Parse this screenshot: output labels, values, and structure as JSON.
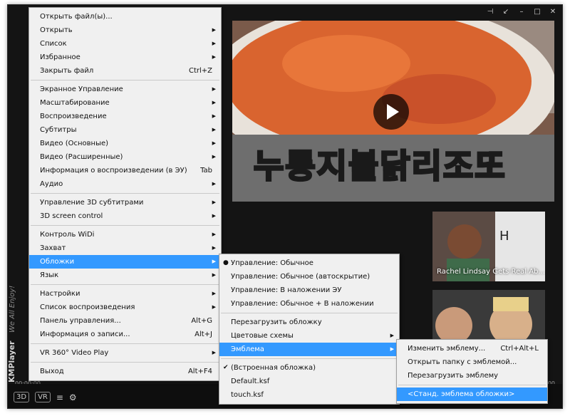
{
  "window": {
    "controls": [
      "pin-icon",
      "minimize-to-tray-icon",
      "minimize-icon",
      "maximize-icon",
      "close-icon"
    ]
  },
  "video": {
    "overlay_text_part1": "누룽지",
    "overlay_text_part2": "불닭",
    "overlay_text_part3": "리조또"
  },
  "thumbnails": [
    {
      "title": "Rachel Lindsay Gets Real Ab..."
    },
    {
      "title": ""
    }
  ],
  "brand": {
    "name": "KMPlayer",
    "tagline": "We All Enjoy!"
  },
  "bottom_bar": {
    "time_left": "00:00:00",
    "time_right": "00:00:00",
    "btn_3d": "3D",
    "btn_vr": "VR"
  },
  "main_menu": {
    "items": [
      {
        "label": "Открыть файл(ы)...",
        "shortcut": "",
        "submenu": false
      },
      {
        "label": "Открыть",
        "shortcut": "",
        "submenu": true
      },
      {
        "label": "Список",
        "shortcut": "",
        "submenu": true
      },
      {
        "label": "Избранное",
        "shortcut": "",
        "submenu": true
      },
      {
        "label": "Закрыть файл",
        "shortcut": "Ctrl+Z",
        "submenu": false
      },
      {
        "label": "Экранное Управление",
        "shortcut": "",
        "submenu": true
      },
      {
        "label": "Масштабирование",
        "shortcut": "",
        "submenu": true
      },
      {
        "label": "Воспроизведение",
        "shortcut": "",
        "submenu": true
      },
      {
        "label": "Субтитры",
        "shortcut": "",
        "submenu": true
      },
      {
        "label": "Видео (Основные)",
        "shortcut": "",
        "submenu": true
      },
      {
        "label": "Видео (Расширенные)",
        "shortcut": "",
        "submenu": true
      },
      {
        "label": "Информация о воспроизведении (в ЭУ)",
        "shortcut": "Tab",
        "submenu": false
      },
      {
        "label": "Аудио",
        "shortcut": "",
        "submenu": true
      },
      {
        "label": "Управление 3D субтитрами",
        "shortcut": "",
        "submenu": true
      },
      {
        "label": "3D screen control",
        "shortcut": "",
        "submenu": true
      },
      {
        "label": "Контроль WiDi",
        "shortcut": "",
        "submenu": true
      },
      {
        "label": "Захват",
        "shortcut": "",
        "submenu": true
      },
      {
        "label": "Обложки",
        "shortcut": "",
        "submenu": true
      },
      {
        "label": "Язык",
        "shortcut": "",
        "submenu": true
      },
      {
        "label": "Настройки",
        "shortcut": "",
        "submenu": true
      },
      {
        "label": "Список воспроизведения",
        "shortcut": "",
        "submenu": true
      },
      {
        "label": "Панель управления...",
        "shortcut": "Alt+G",
        "submenu": false
      },
      {
        "label": "Информация о записи...",
        "shortcut": "Alt+J",
        "submenu": false
      },
      {
        "label": "VR 360° Video Play",
        "shortcut": "",
        "submenu": true
      },
      {
        "label": "Выход",
        "shortcut": "Alt+F4",
        "submenu": false
      }
    ]
  },
  "skins_menu": {
    "items": [
      {
        "label": "Управление: Обычное",
        "submenu": false
      },
      {
        "label": "Управление: Обычное (автоскрытие)",
        "submenu": false
      },
      {
        "label": "Управление: В наложении ЭУ",
        "submenu": false
      },
      {
        "label": "Управление: Обычное + В наложении",
        "submenu": false
      },
      {
        "label": "Перезагрузить обложку",
        "submenu": false
      },
      {
        "label": "Цветовые схемы",
        "submenu": true
      },
      {
        "label": "Эмблема",
        "submenu": true
      },
      {
        "label": "(Встроенная обложка)",
        "submenu": false
      },
      {
        "label": "Default.ksf",
        "submenu": false
      },
      {
        "label": "touch.ksf",
        "submenu": false
      }
    ]
  },
  "logo_menu": {
    "items": [
      {
        "label": "Изменить эмблему...",
        "shortcut": "Ctrl+Alt+L"
      },
      {
        "label": "Открыть папку с эмблемой...",
        "shortcut": ""
      },
      {
        "label": "Перезагрузить эмблему",
        "shortcut": ""
      },
      {
        "label": "<Станд. эмблема обложки>",
        "shortcut": ""
      }
    ]
  },
  "colors": {
    "menu_highlight": "#3399ff",
    "menu_background": "#f0f0f0",
    "player_background": "#141414"
  }
}
